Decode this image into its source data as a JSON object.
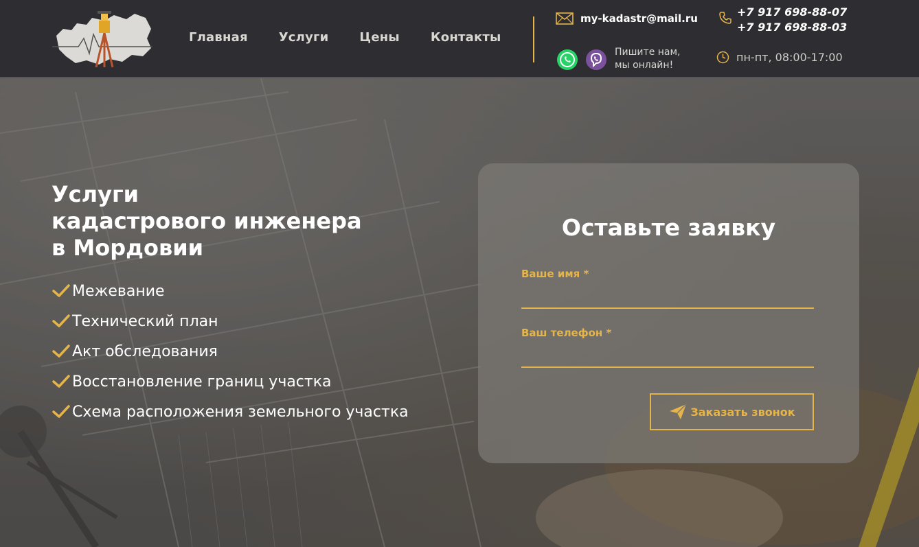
{
  "header": {
    "nav": [
      "Главная",
      "Услуги",
      "Цены",
      "Контакты"
    ],
    "email": "my-kadastr@mail.ru",
    "online_line1": "Пишите нам,",
    "online_line2": "мы онлайн!",
    "phones": [
      "+7 917 698-88-07",
      "+7 917 698-88-03"
    ],
    "hours": "пн-пт, 08:00-17:00"
  },
  "hero": {
    "title_lines": [
      "Услуги",
      "кадастрового инженера",
      "в Мордовии"
    ],
    "services": [
      "Межевание",
      "Технический план",
      "Акт обследования",
      "Восстановление границ участка",
      "Схема расположения земельного участка"
    ]
  },
  "form": {
    "title": "Оставьте заявку",
    "name_label": "Ваше имя *",
    "phone_label": "Ваш телефон *",
    "submit_label": "Заказать звонок"
  },
  "colors": {
    "accent": "#e6b54a",
    "header_bg": "#2e2d31",
    "whatsapp": "#25d366",
    "viber": "#7b519d"
  },
  "icons": [
    "logo-icon",
    "envelope-icon",
    "whatsapp-icon",
    "viber-icon",
    "phone-icon",
    "clock-icon",
    "checkmark-icon",
    "paper-plane-icon"
  ]
}
